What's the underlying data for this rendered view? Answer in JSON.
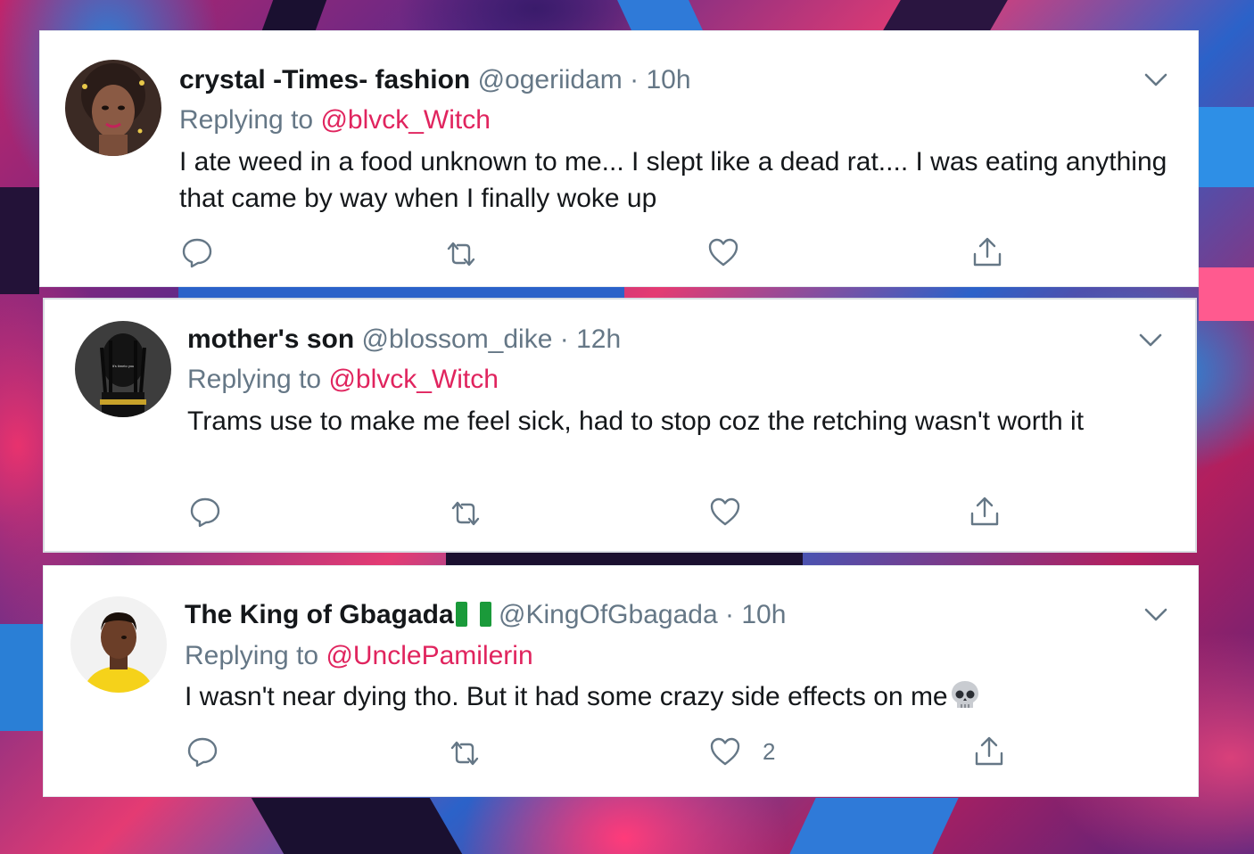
{
  "tweets": [
    {
      "name": "crystal -Times- fashion",
      "handle": "@ogeriidam",
      "separator": "·",
      "time": "10h",
      "replying_prefix": "Replying to",
      "replying_to": "@blvck_Witch",
      "text": "I ate weed in a food unknown to me... I slept like a dead rat.... I was eating anything that came by way when I finally woke up",
      "like_count": ""
    },
    {
      "name": "mother's son",
      "handle": "@blossom_dike",
      "separator": "·",
      "time": "12h",
      "replying_prefix": "Replying to",
      "replying_to": "@blvck_Witch",
      "text": "Trams use to make me feel sick, had to stop coz the retching wasn't worth it",
      "like_count": ""
    },
    {
      "name": "The King of Gbagada",
      "handle": "@KingOfGbagada",
      "separator": "·",
      "time": "10h",
      "replying_prefix": "Replying to",
      "replying_to": "@UnclePamilerin",
      "text": "I wasn't near dying tho. But it had some crazy side effects on me",
      "like_count": "2"
    }
  ],
  "icons": {
    "reply": "reply-icon",
    "retweet": "retweet-icon",
    "like": "heart-icon",
    "share": "share-icon",
    "menu": "chevron-down-icon",
    "flag": "nigeria-flag-icon",
    "emoji": "skull-emoji-icon"
  },
  "colors": {
    "name": "#14171a",
    "meta": "#657786",
    "mention": "#e0245e",
    "icon": "#657786"
  }
}
